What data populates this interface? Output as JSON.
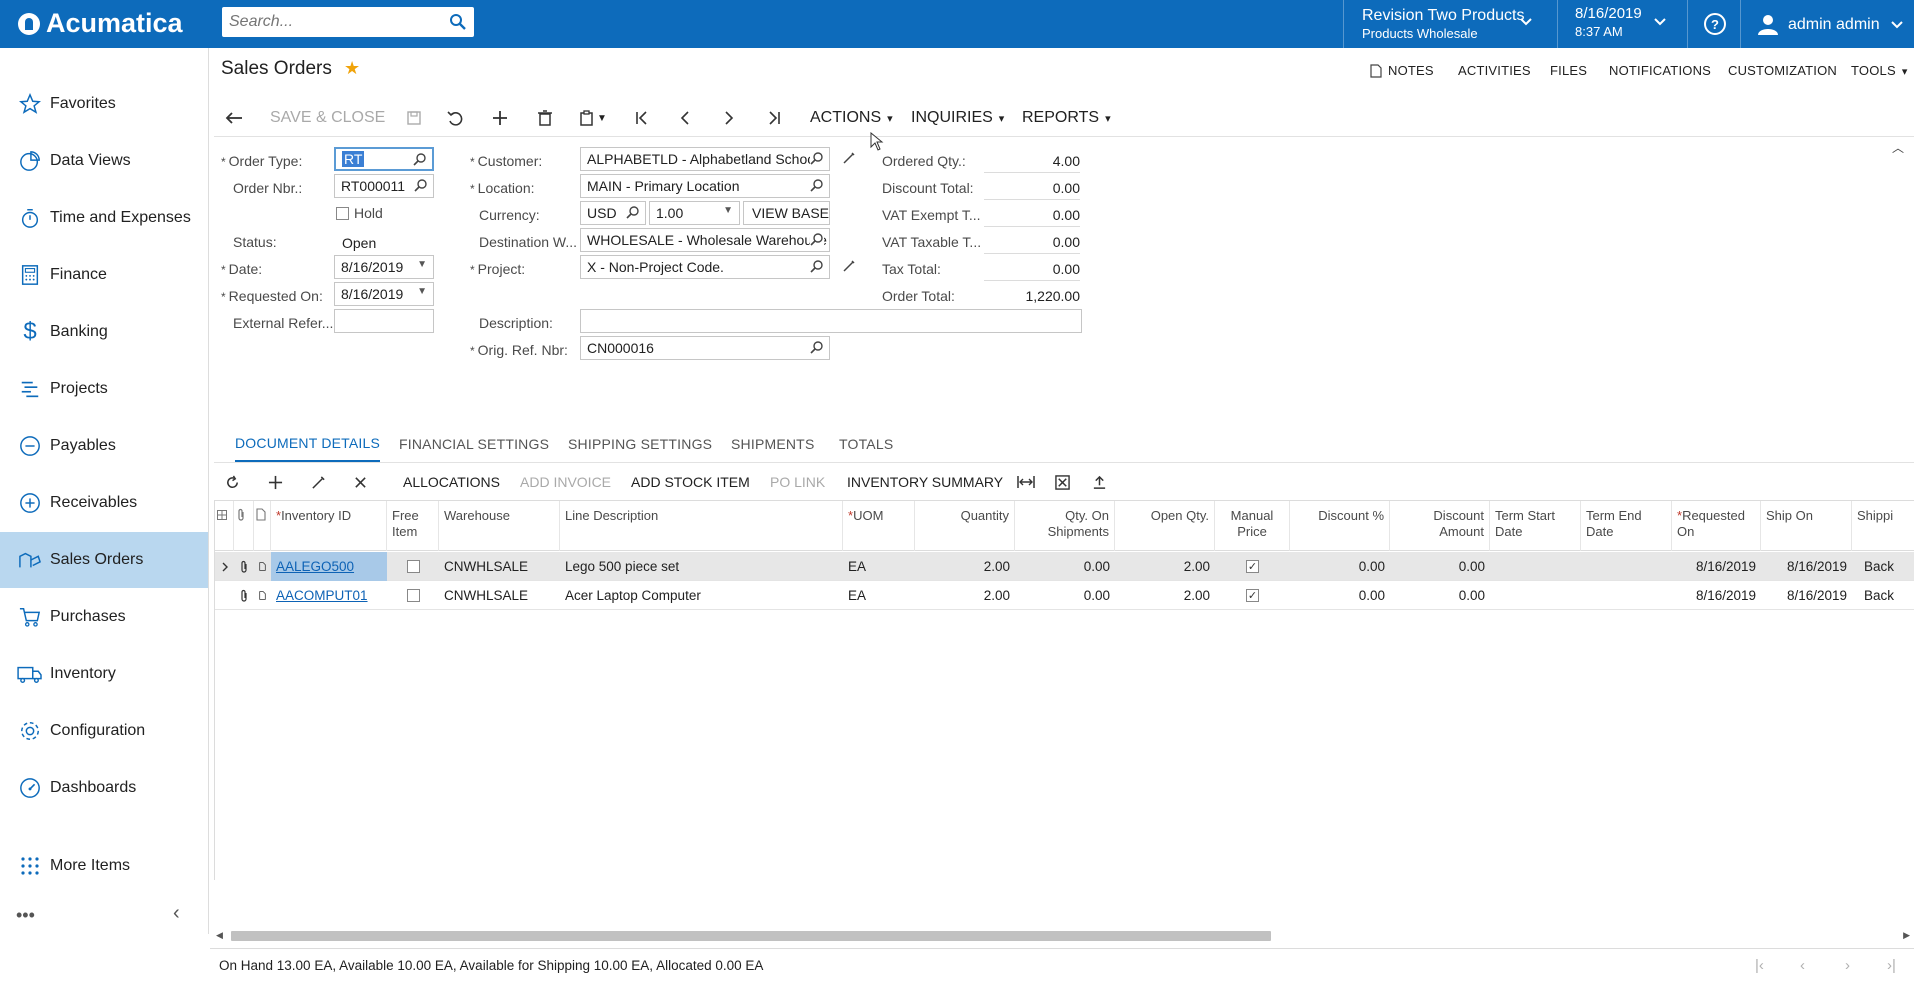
{
  "topbar": {
    "logo": "Acumatica",
    "search_placeholder": "Search...",
    "company": "Revision Two Products",
    "branch": "Products Wholesale",
    "date": "8/16/2019",
    "time": "8:37 AM",
    "user": "admin admin"
  },
  "sidebar": {
    "items": [
      {
        "label": "Favorites",
        "icon": "star-icon"
      },
      {
        "label": "Data Views",
        "icon": "pie-chart-icon"
      },
      {
        "label": "Time and Expenses",
        "icon": "stopwatch-icon"
      },
      {
        "label": "Finance",
        "icon": "calculator-icon"
      },
      {
        "label": "Banking",
        "icon": "dollar-icon"
      },
      {
        "label": "Projects",
        "icon": "projects-icon"
      },
      {
        "label": "Payables",
        "icon": "minus-circle-icon"
      },
      {
        "label": "Receivables",
        "icon": "plus-circle-icon"
      },
      {
        "label": "Sales Orders",
        "icon": "sales-orders-icon"
      },
      {
        "label": "Purchases",
        "icon": "cart-icon"
      },
      {
        "label": "Inventory",
        "icon": "truck-icon"
      },
      {
        "label": "Configuration",
        "icon": "gear-icon"
      },
      {
        "label": "Dashboards",
        "icon": "gauge-icon"
      },
      {
        "label": "More Items",
        "icon": "grid-dots-icon"
      }
    ],
    "more": "•••",
    "collapse": "‹"
  },
  "page": {
    "title": "Sales Orders",
    "links": [
      "NOTES",
      "ACTIVITIES",
      "FILES",
      "NOTIFICATIONS",
      "CUSTOMIZATION",
      "TOOLS"
    ]
  },
  "toolbar": {
    "save_close": "SAVE & CLOSE",
    "actions": "ACTIONS",
    "inquiries": "INQUIRIES",
    "reports": "REPORTS"
  },
  "form": {
    "order_type_label": "Order Type:",
    "order_type": "RT",
    "order_nbr_label": "Order Nbr.:",
    "order_nbr": "RT000011",
    "hold_label": "Hold",
    "status_label": "Status:",
    "status": "Open",
    "date_label": "Date:",
    "date": "8/16/2019",
    "requested_on_label": "Requested On:",
    "requested_on": "8/16/2019",
    "external_ref_label": "External Refer...",
    "external_ref": "",
    "customer_label": "Customer:",
    "customer": "ALPHABETLD - Alphabetland School",
    "location_label": "Location:",
    "location": "MAIN - Primary Location",
    "currency_label": "Currency:",
    "currency": "USD",
    "rate": "1.00",
    "view_base": "VIEW BASE",
    "dest_wh_label": "Destination W...",
    "dest_wh": "WHOLESALE - Wholesale Warehouse",
    "project_label": "Project:",
    "project": "X - Non-Project Code.",
    "description_label": "Description:",
    "description": "",
    "orig_ref_label": "Orig. Ref. Nbr:",
    "orig_ref": "CN000016",
    "ordered_qty_label": "Ordered Qty.:",
    "ordered_qty": "4.00",
    "discount_total_label": "Discount Total:",
    "discount_total": "0.00",
    "vat_exempt_label": "VAT Exempt T...",
    "vat_exempt": "0.00",
    "vat_taxable_label": "VAT Taxable T...",
    "vat_taxable": "0.00",
    "tax_total_label": "Tax Total:",
    "tax_total": "0.00",
    "order_total_label": "Order Total:",
    "order_total": "1,220.00"
  },
  "tabs": [
    "DOCUMENT DETAILS",
    "FINANCIAL SETTINGS",
    "SHIPPING SETTINGS",
    "SHIPMENTS",
    "TOTALS"
  ],
  "grid_toolbar": {
    "allocations": "ALLOCATIONS",
    "add_invoice": "ADD INVOICE",
    "add_stock_item": "ADD STOCK ITEM",
    "po_link": "PO LINK",
    "inventory_summary": "INVENTORY SUMMARY"
  },
  "grid": {
    "headers": {
      "inventory_id": "Inventory ID",
      "free_item": "Free Item",
      "warehouse": "Warehouse",
      "line_description": "Line Description",
      "uom": "UOM",
      "quantity": "Quantity",
      "qty_on_shipments": "Qty. On Shipments",
      "open_qty": "Open Qty.",
      "manual_price": "Manual Price",
      "discount_pct": "Discount %",
      "discount_amount": "Discount Amount",
      "term_start": "Term Start Date",
      "term_end": "Term End Date",
      "requested_on": "Requested On",
      "ship_on": "Ship On",
      "shipping_rule": "Shippi"
    },
    "rows": [
      {
        "inventory_id": "AALEGO500",
        "free_item": false,
        "warehouse": "CNWHLSALE",
        "description": "Lego 500 piece set",
        "uom": "EA",
        "quantity": "2.00",
        "qty_on_shipments": "0.00",
        "open_qty": "2.00",
        "manual_price": true,
        "discount_pct": "0.00",
        "discount_amount": "0.00",
        "term_start": "",
        "term_end": "",
        "requested_on": "8/16/2019",
        "ship_on": "8/16/2019",
        "shipping_rule": "Back"
      },
      {
        "inventory_id": "AACOMPUT01",
        "free_item": false,
        "warehouse": "CNWHLSALE",
        "description": "Acer Laptop Computer",
        "uom": "EA",
        "quantity": "2.00",
        "qty_on_shipments": "0.00",
        "open_qty": "2.00",
        "manual_price": true,
        "discount_pct": "0.00",
        "discount_amount": "0.00",
        "term_start": "",
        "term_end": "",
        "requested_on": "8/16/2019",
        "ship_on": "8/16/2019",
        "shipping_rule": "Back"
      }
    ]
  },
  "statusbar": {
    "text": "On Hand 13.00 EA, Available 10.00 EA, Available for Shipping 10.00 EA, Allocated 0.00 EA"
  },
  "colors": {
    "brand": "#0d6bbb",
    "active_nav": "#b9d7ef",
    "link": "#0d62b5",
    "star": "#f0a30a"
  }
}
